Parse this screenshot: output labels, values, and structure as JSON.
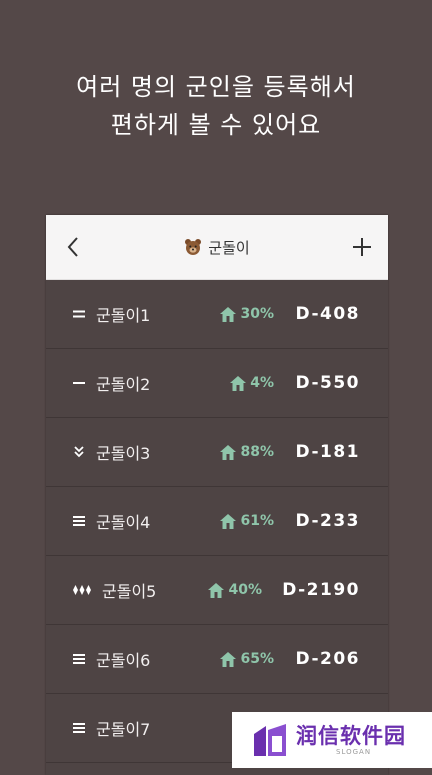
{
  "headline": {
    "line1": "여러 명의 군인을 등록해서",
    "line2": "편하게 볼 수 있어요"
  },
  "topbar": {
    "title": "군돌이",
    "title_icon": "bear-icon",
    "back_icon": "chevron-left-icon",
    "add_icon": "plus-icon"
  },
  "soldiers": [
    {
      "name": "군돌이1",
      "percent": "30%",
      "dday": "D-408",
      "rank_icon": "rank-two-bars-icon"
    },
    {
      "name": "군돌이2",
      "percent": "4%",
      "dday": "D-550",
      "rank_icon": "rank-one-bar-icon"
    },
    {
      "name": "군돌이3",
      "percent": "88%",
      "dday": "D-181",
      "rank_icon": "rank-double-chevron-icon"
    },
    {
      "name": "군돌이4",
      "percent": "61%",
      "dday": "D-233",
      "rank_icon": "rank-three-bars-icon"
    },
    {
      "name": "군돌이5",
      "percent": "40%",
      "dday": "D-2190",
      "rank_icon": "rank-diamonds-icon"
    },
    {
      "name": "군돌이6",
      "percent": "65%",
      "dday": "D-206",
      "rank_icon": "rank-three-bars-icon"
    },
    {
      "name": "군돌이7",
      "percent": "",
      "dday": "",
      "rank_icon": "rank-three-bars-icon"
    }
  ],
  "watermark": {
    "main": "润信软件园",
    "sub": "SLOGAN"
  },
  "colors": {
    "background": "#544848",
    "list_background": "#4e4444",
    "accent_green": "#8fc5aa",
    "topbar": "#f6f5f5"
  }
}
